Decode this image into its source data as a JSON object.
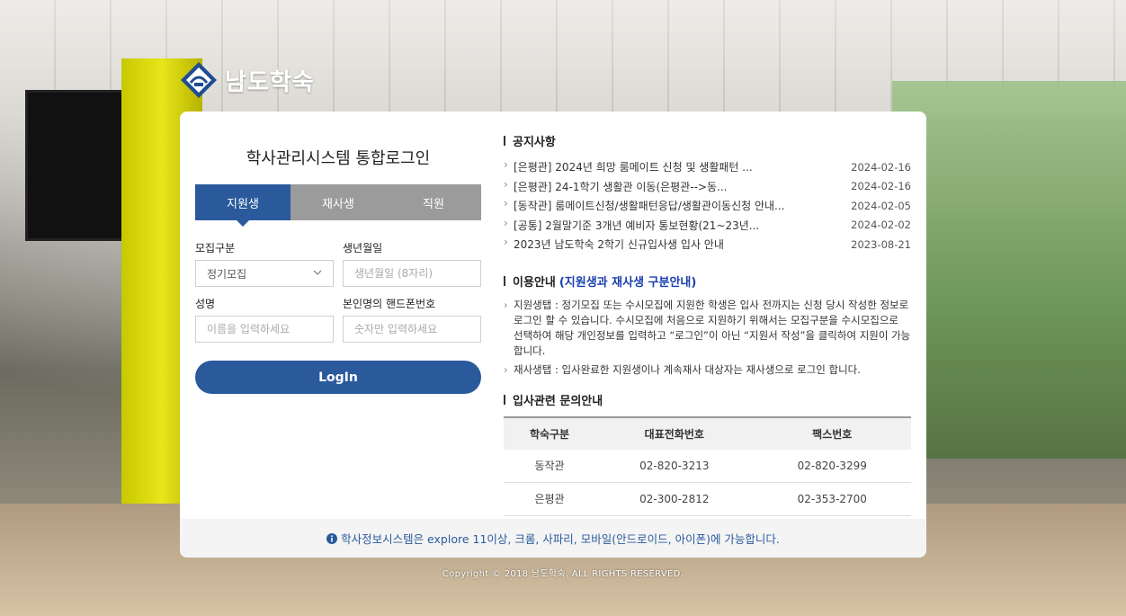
{
  "brand": {
    "name": "남도학숙",
    "accent": "#2a5a9c"
  },
  "login": {
    "title": "학사관리시스템 통합로그인",
    "tabs": [
      {
        "label": "지원생",
        "active": true
      },
      {
        "label": "재사생"
      },
      {
        "label": "직원"
      }
    ],
    "fields": {
      "recruit": {
        "label": "모집구분",
        "value": "정기모집"
      },
      "birth": {
        "label": "생년월일",
        "placeholder": "생년월일 (8자리)"
      },
      "name": {
        "label": "성명",
        "placeholder": "이름을 입력하세요"
      },
      "phone": {
        "label": "본인명의 핸드폰번호",
        "placeholder": "숫자만 입력하세요"
      }
    },
    "button": "LogIn"
  },
  "notice": {
    "title": "공지사항",
    "items": [
      {
        "title": "[은평관] 2024년 희망 룸메이트 신청 및 생활패턴 ...",
        "date": "2024-02-16"
      },
      {
        "title": "[은평관] 24-1학기 생활관 이동(은평관-->동...",
        "date": "2024-02-16"
      },
      {
        "title": "[동작관] 룸메이트신청/생활패턴응답/생활관이동신청 안내...",
        "date": "2024-02-05"
      },
      {
        "title": "[공통] 2월말기준 3개년 예비자 통보현황(21~23년...",
        "date": "2024-02-02"
      },
      {
        "title": "2023년 남도학숙 2학기 신규입사생 입사 안내",
        "date": "2023-08-21"
      }
    ]
  },
  "usage": {
    "title": "이용안내",
    "highlight": "(지원생과 재사생 구분안내)",
    "items": [
      "지원생탭 : 정기모집 또는 수시모집에 지원한 학생은 입사 전까지는 신청 당시 작성한 정보로 로그인 할 수 있습니다. 수시모집에 처음으로 지원하기 위해서는 모집구분을 수시모집으로 선택하여 해당 개인정보를 입력하고 “로그인”이 아닌 “지원서 작성”을 클릭하여 지원이 가능합니다.",
      "재사생탭 : 입사완료한 지원생이나 계속재사 대상자는 재사생으로 로그인 합니다."
    ]
  },
  "contact": {
    "title": "입사관련 문의안내",
    "headers": [
      "학숙구분",
      "대표전화번호",
      "팩스번호"
    ],
    "rows": [
      [
        "동작관",
        "02-820-3213",
        "02-820-3299"
      ],
      [
        "은평관",
        "02-300-2812",
        "02-353-2700"
      ]
    ]
  },
  "footer_note": "학사정보시스템은 explore 11이상, 크롬, 사파리, 모바일(안드로이드, 아이폰)에 가능합니다.",
  "copyright": "Copyright © 2018 남도학숙. ALL RIGHTS RESERVED."
}
